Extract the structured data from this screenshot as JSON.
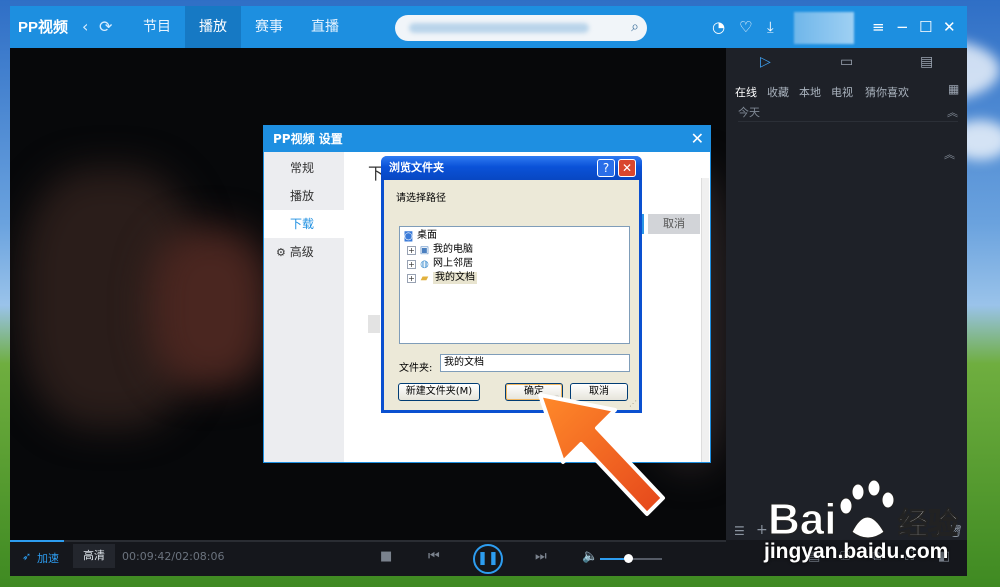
{
  "app": {
    "logo": "PP视频",
    "tabs": [
      {
        "label": "节目",
        "active": false
      },
      {
        "label": "播放",
        "active": true
      },
      {
        "label": "赛事",
        "active": false
      },
      {
        "label": "直播",
        "active": false
      }
    ],
    "icons": [
      "back-icon",
      "refresh-icon",
      "search-icon",
      "clock-icon",
      "heart-icon",
      "download-icon",
      "menu-icon",
      "minimize-icon",
      "maximize-icon",
      "close-icon"
    ]
  },
  "right_panel": {
    "subtabs": [
      {
        "label": "在线",
        "active": true
      },
      {
        "label": "收藏",
        "active": false
      },
      {
        "label": "本地",
        "active": false
      },
      {
        "label": "电视",
        "active": false
      },
      {
        "label": "猜你喜欢",
        "active": false
      }
    ],
    "today_label": "今天"
  },
  "controls": {
    "accelerate_label": "加速",
    "quality_label": "高清",
    "time": "00:09:42/02:08:06",
    "volume_level": 0.45,
    "accent": "#2d9df0"
  },
  "settings_dialog": {
    "title": "PP视频 设置",
    "nav": [
      {
        "label": "常规",
        "active": false
      },
      {
        "label": "播放",
        "active": false
      },
      {
        "label": "下载",
        "active": true
      },
      {
        "label": "高级",
        "active": false,
        "icon": "gear-icon"
      }
    ],
    "heading": "下",
    "cancel_label": "取消"
  },
  "browse_dialog": {
    "title": "浏览文件夹",
    "help_label": "?",
    "close_label": "✕",
    "prompt": "请选择路径",
    "tree": {
      "root": "桌面",
      "children": [
        "我的电脑",
        "网上邻居",
        "我的文档"
      ],
      "selected": "我的文档"
    },
    "folder_label": "文件夹:",
    "folder_value": "我的文档",
    "new_folder_label": "新建文件夹(M)",
    "ok_label": "确定",
    "cancel_label": "取消"
  },
  "watermark": {
    "brand": "Bai 经验",
    "url": "jingyan.baidu.com"
  }
}
